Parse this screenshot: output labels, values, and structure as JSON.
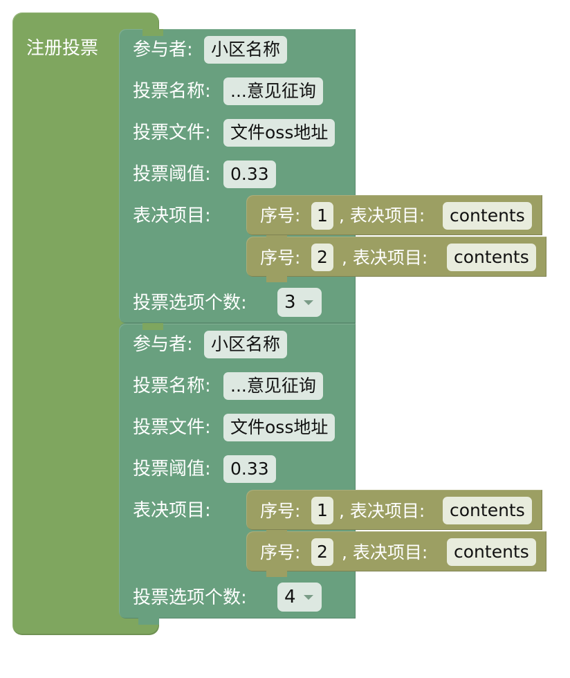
{
  "outer": {
    "title": "注册投票"
  },
  "blocks": [
    {
      "participant_label": "参与者:",
      "participant_value": "小区名称",
      "vote_name_label": "投票名称:",
      "vote_name_value": "...意见征询",
      "vote_file_label": "投票文件:",
      "vote_file_value": "文件oss地址",
      "threshold_label": "投票阈值:",
      "threshold_value": "0.33",
      "items_label": "表决项目:",
      "items": [
        {
          "seq_label": "序号:",
          "seq_value": "1",
          "item_label": ", 表决项目:",
          "item_value": "contents"
        },
        {
          "seq_label": "序号:",
          "seq_value": "2",
          "item_label": ", 表决项目:",
          "item_value": "contents"
        }
      ],
      "option_count_label": "投票选项个数:",
      "option_count_value": "3"
    },
    {
      "participant_label": "参与者:",
      "participant_value": "小区名称",
      "vote_name_label": "投票名称:",
      "vote_name_value": "...意见征询",
      "vote_file_label": "投票文件:",
      "vote_file_value": "文件oss地址",
      "threshold_label": "投票阈值:",
      "threshold_value": "0.33",
      "items_label": "表决项目:",
      "items": [
        {
          "seq_label": "序号:",
          "seq_value": "1",
          "item_label": ", 表决项目:",
          "item_value": "contents"
        },
        {
          "seq_label": "序号:",
          "seq_value": "2",
          "item_label": ", 表决项目:",
          "item_value": "contents"
        }
      ],
      "option_count_label": "投票选项个数:",
      "option_count_value": "4"
    }
  ],
  "colors": {
    "outer_block": "#7fa65f",
    "vote_block": "#69a07f",
    "item_block": "#9c9f63",
    "field_bg": "#dde8e1"
  }
}
